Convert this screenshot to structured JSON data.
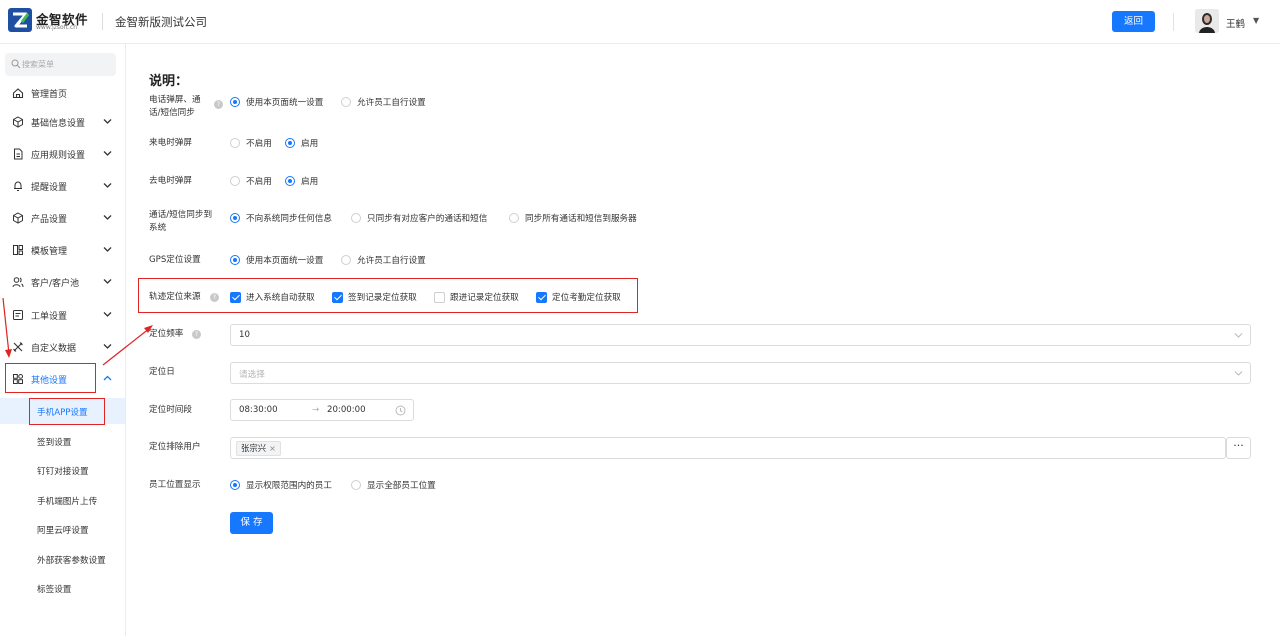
{
  "header": {
    "logo_name": "金智软件",
    "logo_url": "www.jzsoft.cn",
    "company": "金智新版测试公司",
    "back_label": "返回",
    "user_name": "王鹤",
    "user_caret": "▼",
    "brand_color": "#1677ff"
  },
  "sidebar": {
    "search_placeholder": "搜索菜单",
    "items": [
      {
        "label": "管理首页",
        "icon": "home-icon"
      },
      {
        "label": "基础信息设置",
        "icon": "cube-icon"
      },
      {
        "label": "应用规则设置",
        "icon": "document-icon"
      },
      {
        "label": "提醒设置",
        "icon": "bell-icon"
      },
      {
        "label": "产品设置",
        "icon": "box-icon"
      },
      {
        "label": "模板管理",
        "icon": "template-icon"
      },
      {
        "label": "客户/客户池",
        "icon": "customer-icon"
      },
      {
        "label": "工单设置",
        "icon": "ticket-icon"
      },
      {
        "label": "自定义数据",
        "icon": "tools-icon"
      },
      {
        "label": "其他设置",
        "icon": "grid-icon"
      }
    ],
    "sub_items": [
      {
        "label": "手机APP设置"
      },
      {
        "label": "签到设置"
      },
      {
        "label": "钉钉对接设置"
      },
      {
        "label": "手机端图片上传"
      },
      {
        "label": "阿里云呼设置"
      },
      {
        "label": "外部获客参数设置"
      },
      {
        "label": "标签设置"
      }
    ]
  },
  "main": {
    "heading": "说明：",
    "sync_label": "电话弹屏、通话/短信同步",
    "sync_label_line1": "电话弹屏、通",
    "sync_label_line2": "话/短信同步",
    "sync_options": [
      "使用本页面统一设置",
      "允许员工自行设置"
    ],
    "incoming_label": "来电时弹屏",
    "incoming_options": [
      "不启用",
      "启用"
    ],
    "outgoing_label": "去电时弹屏",
    "outgoing_options": [
      "不启用",
      "启用"
    ],
    "callsync_label_line1": "通话/短信同步到",
    "callsync_label_line2": "系统",
    "callsync_options": [
      "不向系统同步任何信息",
      "只同步有对应客户的通话和短信",
      "同步所有通话和短信到服务器"
    ],
    "gps_label": "GPS定位设置",
    "gps_options": [
      "使用本页面统一设置",
      "允许员工自行设置"
    ],
    "track_label": "轨迹定位来源",
    "track_options": [
      "进入系统自动获取",
      "签到记录定位获取",
      "跟进记录定位获取",
      "定位考勤定位获取"
    ],
    "track_checked": [
      true,
      true,
      false,
      true
    ],
    "freq_label": "定位频率",
    "freq_value": "10",
    "day_label": "定位日",
    "day_placeholder": "请选择",
    "period_label": "定位时间段",
    "period_start": "08:30:00",
    "period_arrow": "→",
    "period_end": "20:00:00",
    "exclude_label": "定位排除用户",
    "exclude_tag": "张宗兴",
    "exclude_more": "···",
    "staff_label": "员工位置显示",
    "staff_options": [
      "显示权限范围内的员工",
      "显示全部员工位置"
    ],
    "save_label": "保 存",
    "help_glyph": "?"
  }
}
